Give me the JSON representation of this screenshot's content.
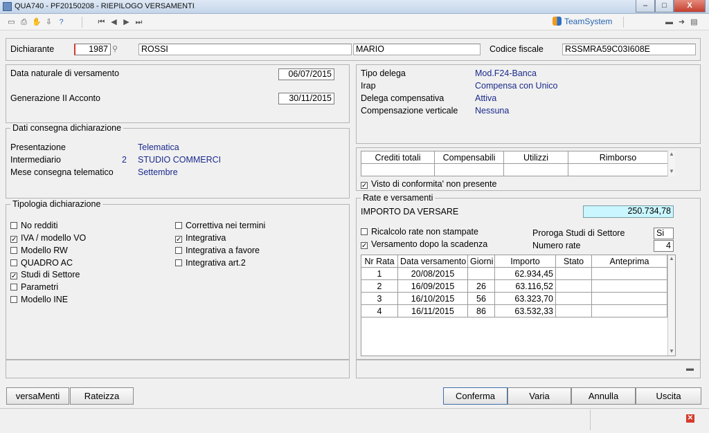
{
  "window": {
    "title": "QUA740  - PF20150208 -  RIEPILOGO VERSAMENTI",
    "minimize": "–",
    "maximize": "□",
    "close": "X"
  },
  "toolbar": {
    "brand": "TeamSystem",
    "icons": [
      "window-icon",
      "print-icon",
      "attach-icon",
      "export-icon",
      "help-icon",
      "first-icon",
      "prev-icon",
      "next-icon",
      "last-icon",
      "notes-icon",
      "forward-icon",
      "document-icon"
    ]
  },
  "header": {
    "dichiarante_label": "Dichiarante",
    "dichiarante_code": "1987",
    "cognome": "ROSSI",
    "nome": "MARIO",
    "codice_fiscale_label": "Codice fiscale",
    "codice_fiscale": "RSSMRA59C03I608E"
  },
  "dates": {
    "data_naturale_label": "Data naturale di versamento",
    "data_naturale": "06/07/2015",
    "generazione_label": "Generazione II Acconto",
    "generazione": "30/11/2015"
  },
  "delega": {
    "tipo_label": "Tipo delega",
    "tipo": "Mod.F24-Banca",
    "irap_label": "Irap",
    "irap": "Compensa con Unico",
    "compensativa_label": "Delega compensativa",
    "compensativa": "Attiva",
    "verticale_label": "Compensazione verticale",
    "verticale": "Nessuna"
  },
  "consegna": {
    "title": "Dati consegna dichiarazione",
    "presentazione_label": "Presentazione",
    "presentazione": "Telematica",
    "intermediario_label": "Intermediario",
    "intermediario_code": "2",
    "intermediario": "STUDIO COMMERCI",
    "mese_label": "Mese consegna telematico",
    "mese": "Settembre"
  },
  "crediti": {
    "headers": [
      "Crediti totali",
      "Compensabili",
      "Utilizzi",
      "Rimborso"
    ],
    "visto_label": "Visto di conformita' non presente",
    "visto_checked": true
  },
  "tipologia": {
    "title": "Tipologia dichiarazione",
    "left": [
      {
        "label": "No redditi",
        "checked": false
      },
      {
        "label": "IVA / modello VO",
        "checked": true
      },
      {
        "label": "Modello RW",
        "checked": false
      },
      {
        "label": "QUADRO AC",
        "checked": false
      },
      {
        "label": "Studi di Settore",
        "checked": true
      },
      {
        "label": "Parametri",
        "checked": false
      },
      {
        "label": "Modello INE",
        "checked": false
      }
    ],
    "right": [
      {
        "label": "Correttiva nei termini",
        "checked": false
      },
      {
        "label": "Integrativa",
        "checked": true
      },
      {
        "label": "Integrativa a favore",
        "checked": false
      },
      {
        "label": "Integrativa art.2",
        "checked": false
      }
    ]
  },
  "rate": {
    "title": "Rate e versamenti",
    "importo_label": "IMPORTO DA VERSARE",
    "importo": "250.734,78",
    "ricalcolo_label": "Ricalcolo rate non stampate",
    "ricalcolo_checked": false,
    "dopo_scadenza_label": "Versamento dopo la scadenza",
    "dopo_scadenza_checked": true,
    "proroga_label": "Proroga Studi di Settore",
    "proroga": "Si",
    "numero_rate_label": "Numero rate",
    "numero_rate": "4",
    "headers": [
      "Nr Rata",
      "Data versamento",
      "Giorni",
      "Importo",
      "Stato",
      "Anteprima"
    ],
    "rows": [
      {
        "nr": "1",
        "data": "20/08/2015",
        "giorni": "",
        "importo": "62.934,45",
        "stato": "",
        "anteprima": ""
      },
      {
        "nr": "2",
        "data": "16/09/2015",
        "giorni": "26",
        "importo": "63.116,52",
        "stato": "",
        "anteprima": ""
      },
      {
        "nr": "3",
        "data": "16/10/2015",
        "giorni": "56",
        "importo": "63.323,70",
        "stato": "",
        "anteprima": ""
      },
      {
        "nr": "4",
        "data": "16/11/2015",
        "giorni": "86",
        "importo": "63.532,33",
        "stato": "",
        "anteprima": ""
      }
    ]
  },
  "buttons": {
    "versamenti": "versaMenti",
    "rateizza": "Rateizza",
    "conferma": "Conferma",
    "varia": "Varia",
    "annulla": "Annulla",
    "uscita": "Uscita"
  },
  "colors": {
    "accent_blue": "#1a2a8c",
    "highlight_cyan": "#c9f6ff",
    "close_red": "#c4402f"
  }
}
